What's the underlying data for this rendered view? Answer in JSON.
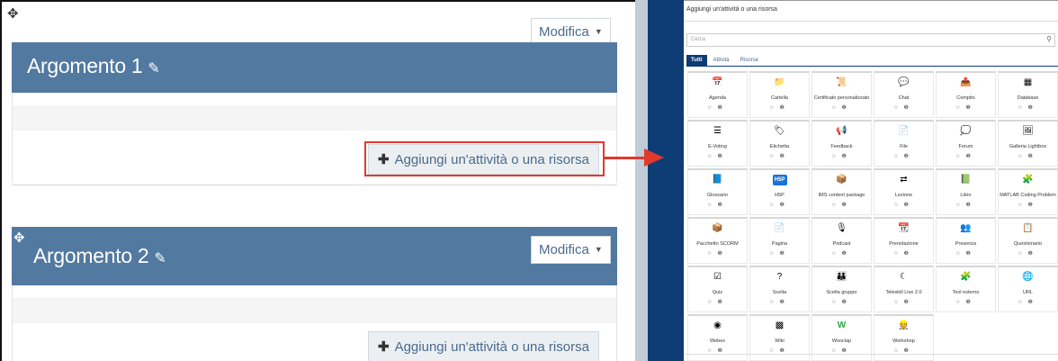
{
  "left": {
    "section1": {
      "title": "Argomento 1",
      "edit_label": "Modifica",
      "add_label": "Aggiungi un'attività o una risorsa"
    },
    "section2": {
      "title": "Argomento 2",
      "edit_label": "Modifica",
      "add_label": "Aggiungi un'attività o una risorsa"
    }
  },
  "modal": {
    "title": "Aggiungi un'attività o una risorsa",
    "search_placeholder": "Cerca",
    "tabs": [
      "Tutti",
      "Attività",
      "Risorse"
    ],
    "active_tab": "Tutti",
    "items": [
      {
        "name": "Agenda",
        "icon": "calendar-icon",
        "glyph": "📅"
      },
      {
        "name": "Cartella",
        "icon": "folder-icon",
        "glyph": "📁"
      },
      {
        "name": "Certificato personalizzato",
        "icon": "certificate-icon",
        "glyph": "📜"
      },
      {
        "name": "Chat",
        "icon": "chat-icon",
        "glyph": "💬"
      },
      {
        "name": "Compito",
        "icon": "assignment-icon",
        "glyph": "📤"
      },
      {
        "name": "Database",
        "icon": "database-icon",
        "glyph": "▦"
      },
      {
        "name": "E-Voting",
        "icon": "voting-icon",
        "glyph": "☰"
      },
      {
        "name": "Etichetta",
        "icon": "label-icon",
        "glyph": "🏷"
      },
      {
        "name": "Feedback",
        "icon": "megaphone-icon",
        "glyph": "📢"
      },
      {
        "name": "File",
        "icon": "file-icon",
        "glyph": "📄"
      },
      {
        "name": "Forum",
        "icon": "forum-icon",
        "glyph": "💭"
      },
      {
        "name": "Galleria Lightbox",
        "icon": "gallery-icon",
        "glyph": "🖼"
      },
      {
        "name": "Glossario",
        "icon": "glossary-icon",
        "glyph": "📘"
      },
      {
        "name": "H5P",
        "icon": "h5p-icon",
        "glyph": "H5P"
      },
      {
        "name": "IMS content package",
        "icon": "package-icon",
        "glyph": "📦"
      },
      {
        "name": "Lezione",
        "icon": "lesson-icon",
        "glyph": "⇄"
      },
      {
        "name": "Libro",
        "icon": "book-icon",
        "glyph": "📗"
      },
      {
        "name": "MATLAB Coding Problem",
        "icon": "puzzle-icon",
        "glyph": "🧩"
      },
      {
        "name": "Pacchetto SCORM",
        "icon": "scorm-icon",
        "glyph": "📦"
      },
      {
        "name": "Pagina",
        "icon": "page-icon",
        "glyph": "📄"
      },
      {
        "name": "Podcast",
        "icon": "podcast-icon",
        "glyph": "🎙"
      },
      {
        "name": "Prenotazione",
        "icon": "booking-icon",
        "glyph": "📆"
      },
      {
        "name": "Presenza",
        "icon": "attendance-icon",
        "glyph": "👥"
      },
      {
        "name": "Questionario",
        "icon": "questionnaire-icon",
        "glyph": "📋"
      },
      {
        "name": "Quiz",
        "icon": "quiz-icon",
        "glyph": "☑"
      },
      {
        "name": "Scelta",
        "icon": "choice-icon",
        "glyph": "?"
      },
      {
        "name": "Scelta gruppo",
        "icon": "group-choice-icon",
        "glyph": "👪"
      },
      {
        "name": "Teleskill Live 2.0",
        "icon": "teleskill-icon",
        "glyph": "☾"
      },
      {
        "name": "Tool esterno",
        "icon": "external-tool-icon",
        "glyph": "🧩"
      },
      {
        "name": "URL",
        "icon": "url-icon",
        "glyph": "🌐"
      },
      {
        "name": "Webex",
        "icon": "webex-icon",
        "glyph": "◉"
      },
      {
        "name": "Wiki",
        "icon": "wiki-icon",
        "glyph": "▩"
      },
      {
        "name": "Wooclap",
        "icon": "wooclap-icon",
        "glyph": "W"
      },
      {
        "name": "Workshop",
        "icon": "workshop-icon",
        "glyph": "👷"
      }
    ],
    "star": "☆",
    "info": "❶"
  },
  "colors": {
    "section_header": "#5279a0",
    "modal_accent": "#0e3c74",
    "highlight": "#e2392d"
  }
}
